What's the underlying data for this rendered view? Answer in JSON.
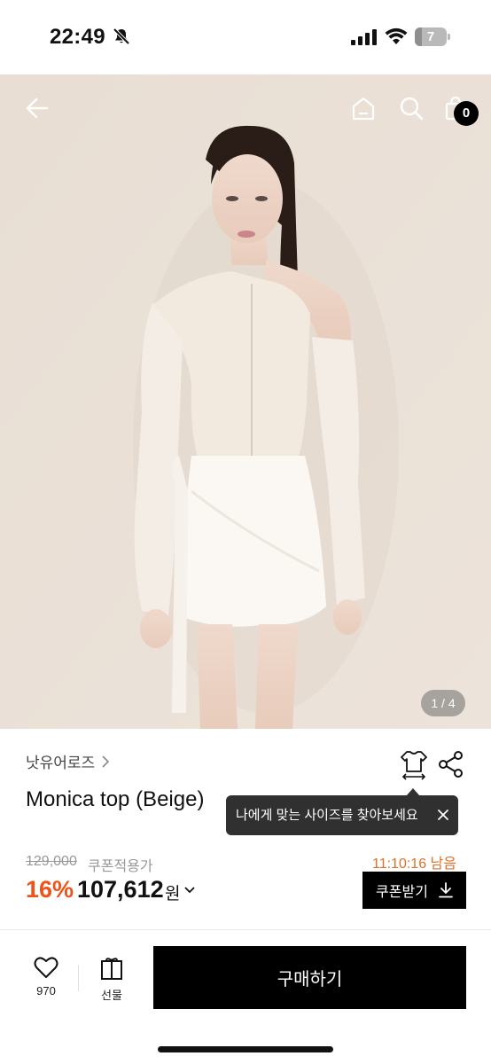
{
  "status_bar": {
    "time": "22:49",
    "battery_level": "7",
    "icons": [
      "bell-slash-icon",
      "cellular-signal-icon",
      "wifi-icon",
      "battery-icon"
    ]
  },
  "header": {
    "icons": [
      "back-arrow-icon",
      "home-icon",
      "search-icon",
      "shopping-bag-icon"
    ],
    "cart_count": "0"
  },
  "gallery": {
    "counter": "1 / 4",
    "current": 1,
    "total": 4
  },
  "product": {
    "brand": "낫유어로즈",
    "name": "Monica top (Beige)",
    "size_tooltip": "나에게 맞는 사이즈를 찾아보세요",
    "original_price": "129,000",
    "coupon_note": "쿠폰적용가",
    "timer": "11:10:16 남음",
    "discount": "16%",
    "price": "107,612",
    "currency": "원",
    "coupon_button": "쿠폰받기"
  },
  "bottom_bar": {
    "like_count": "970",
    "gift_label": "선물",
    "buy_label": "구매하기"
  },
  "colors": {
    "accent_discount": "#f0531a",
    "timer": "#e07028",
    "button_bg": "#000000",
    "tooltip_bg": "#303030"
  }
}
